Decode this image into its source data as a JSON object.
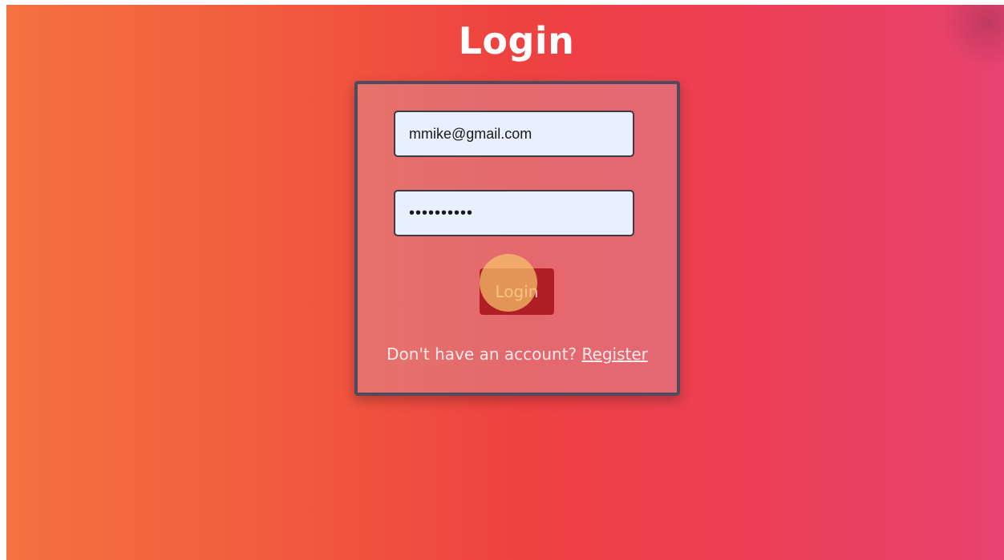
{
  "page": {
    "title": "Login"
  },
  "form": {
    "email_value": "mmike@gmail.com",
    "password_display": "••••••••••",
    "login_button_label": "Login",
    "footer_prompt": "Don't have an account?",
    "register_link_label": "Register"
  },
  "colors": {
    "gradient_start": "#f47240",
    "gradient_mid": "#ee4141",
    "gradient_end": "#e8436f",
    "card_border": "#4f4a5d",
    "input_background": "#e8f0fe",
    "button_background": "#b01e26",
    "click_indicator": "#f6c46c"
  }
}
